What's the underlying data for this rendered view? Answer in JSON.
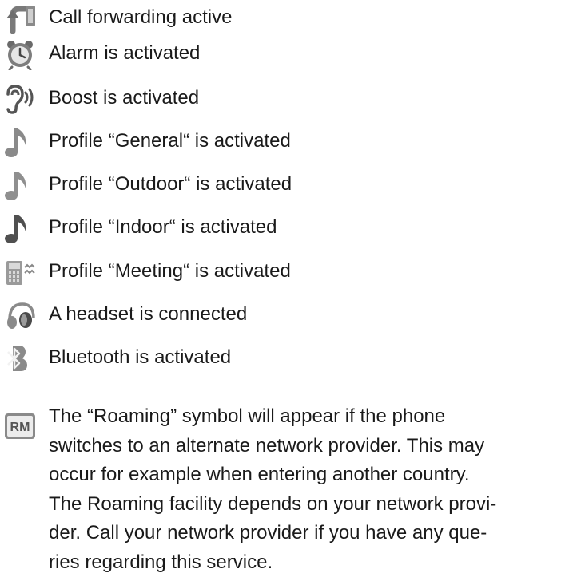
{
  "items": [
    {
      "icon": "call-forwarding-icon",
      "label": "Call forwarding active"
    },
    {
      "icon": "alarm-clock-icon",
      "label": "Alarm is activated"
    },
    {
      "icon": "ear-boost-icon",
      "label": "Boost is activated"
    },
    {
      "icon": "music-note-icon",
      "label": "Profile “General“ is activated"
    },
    {
      "icon": "music-note-icon",
      "label": "Profile “Outdoor“ is activated"
    },
    {
      "icon": "music-note-icon",
      "label": "Profile “Indoor“ is activated"
    },
    {
      "icon": "vibrate-phone-icon",
      "label": "Profile “Meeting“ is activated"
    },
    {
      "icon": "headset-icon",
      "label": "A headset is connected"
    },
    {
      "icon": "bluetooth-icon",
      "label": "Bluetooth is activated"
    }
  ],
  "roaming": {
    "icon": "roaming-rm-icon",
    "icon_text": "RM",
    "lines": [
      "The “Roaming” symbol will appear if the phone",
      "switches to an alternate network provider. This may",
      "occur for example when entering another country.",
      "The Roaming facility depends on your network provi-",
      "der. Call your network provider if you have any que-",
      "ries regarding this service."
    ]
  }
}
